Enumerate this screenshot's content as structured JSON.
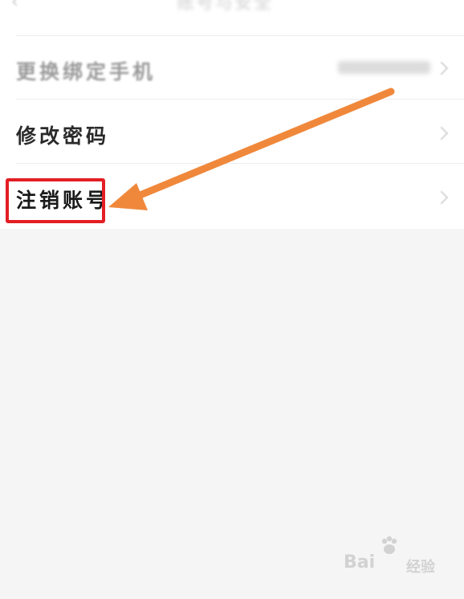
{
  "header": {
    "back_icon": "back-arrow-icon",
    "title": "账号与安全"
  },
  "settings": {
    "rows": [
      {
        "label": "更换绑定手机",
        "value": ""
      },
      {
        "label": "修改密码"
      },
      {
        "label": "注销账号"
      }
    ]
  },
  "annotation": {
    "highlight_color": "#e31e24",
    "arrow_color": "#f0883b"
  },
  "watermark": {
    "text": "Bai",
    "sub_text": "经验"
  }
}
